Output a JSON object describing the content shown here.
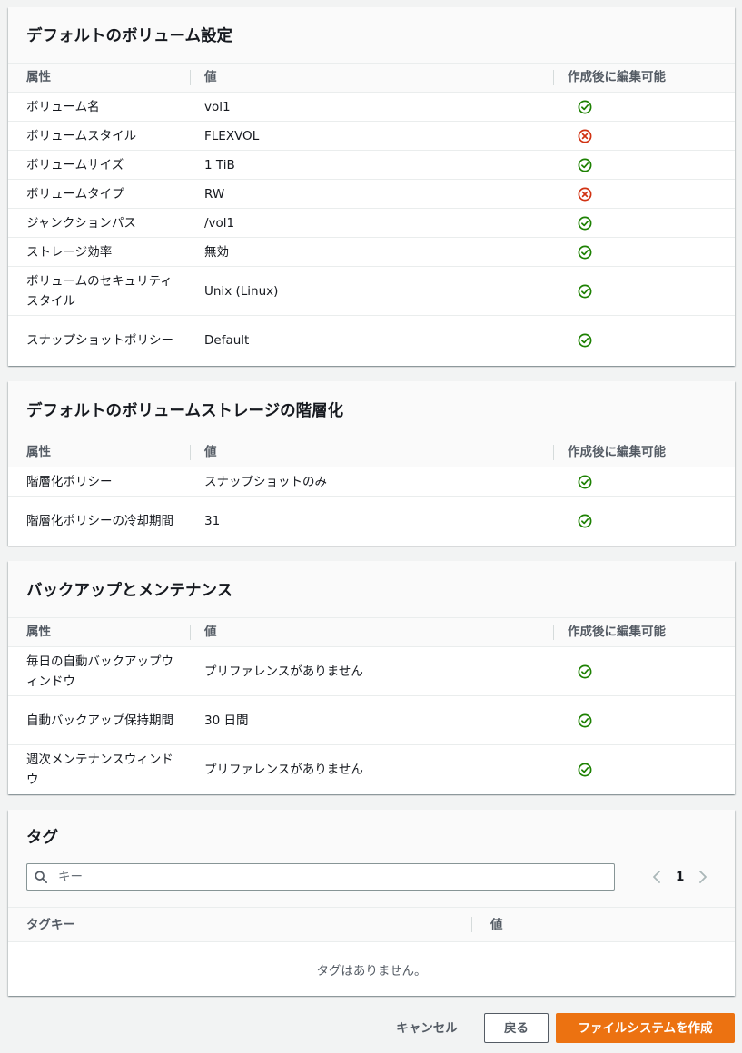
{
  "colors": {
    "ok": "#1d8102",
    "no": "#d13212",
    "primary": "#ec7211"
  },
  "columns": {
    "attr": "属性",
    "value": "値",
    "editable": "作成後に編集可能"
  },
  "volume": {
    "title": "デフォルトのボリューム設定",
    "rows": [
      {
        "attr": "ボリューム名",
        "value": "vol1",
        "editable": "ok"
      },
      {
        "attr": "ボリュームスタイル",
        "value": "FLEXVOL",
        "editable": "no"
      },
      {
        "attr": "ボリュームサイズ",
        "value": "1 TiB",
        "editable": "ok"
      },
      {
        "attr": "ボリュームタイプ",
        "value": "RW",
        "editable": "no"
      },
      {
        "attr": "ジャンクションパス",
        "value": "/vol1",
        "editable": "ok"
      },
      {
        "attr": "ストレージ効率",
        "value": "無効",
        "editable": "ok"
      },
      {
        "attr": "ボリュームのセキュリティスタイル",
        "value": "Unix (Linux)",
        "editable": "ok"
      },
      {
        "attr": "スナップショットポリシー",
        "value": "Default",
        "editable": "ok"
      }
    ]
  },
  "tiering": {
    "title": "デフォルトのボリュームストレージの階層化",
    "rows": [
      {
        "attr": "階層化ポリシー",
        "value": "スナップショットのみ",
        "editable": "ok"
      },
      {
        "attr": "階層化ポリシーの冷却期間",
        "value": "31",
        "editable": "ok"
      }
    ]
  },
  "backup": {
    "title": "バックアップとメンテナンス",
    "rows": [
      {
        "attr": "毎日の自動バックアップウィンドウ",
        "value": "プリファレンスがありません",
        "editable": "ok"
      },
      {
        "attr": "自動バックアップ保持期間",
        "value": "30 日間",
        "editable": "ok"
      },
      {
        "attr": "週次メンテナンスウィンドウ",
        "value": "プリファレンスがありません",
        "editable": "ok"
      }
    ]
  },
  "tags": {
    "title": "タグ",
    "search_placeholder": "キー",
    "page": "1",
    "col_key": "タグキー",
    "col_value": "値",
    "empty": "タグはありません。"
  },
  "footer": {
    "cancel": "キャンセル",
    "back": "戻る",
    "create": "ファイルシステムを作成"
  }
}
